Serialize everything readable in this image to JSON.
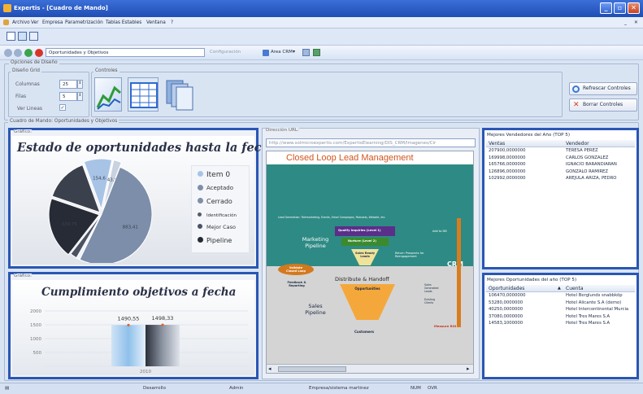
{
  "window": {
    "title": "Expertis - [Cuadro de Mando]"
  },
  "menu": {
    "items": [
      "Archivo",
      "Ver",
      "Empresa",
      "Parametrización",
      "Tablas Estables",
      "Ventana",
      "?"
    ]
  },
  "toolbar": {
    "combo_value": "Oportunidades y Objetivos",
    "config_label": "Configuración",
    "area_label": "Area CRM"
  },
  "options": {
    "group_label": "Opciones de Diseño",
    "grid_label": "Diseño Grid",
    "columns_label": "Columnas",
    "columns_value": "25",
    "rows_label": "Filas",
    "rows_value": "5",
    "lines_label": "Ver Lineas",
    "controls_label": "Controles",
    "refresh_label": "Refrescar Controles",
    "delete_label": "Borrar Controles"
  },
  "dashboard": {
    "label": "Cuadro de Mando: Oportunidades y Objetivos"
  },
  "pie_panel": {
    "label": "Gráfico:"
  },
  "bar_panel": {
    "label": "Gráfico:"
  },
  "url_panel": {
    "label": "Dirección URL:",
    "url": "http://www.solmicroexpertis.com/ExpertisElearning/DIS_CRM/Imagenes/Cir"
  },
  "clm": {
    "title": "Closed Loop Lead Management",
    "top_line": "Lead Generation: Telemarketing, Events, Email Campaigns, Podcasts, Website, etc.",
    "marketing_pipeline": "Marketing Pipeline",
    "qualify": "Qualify Inquiries (Level 1)",
    "nurture": "Nurture (Level 2)",
    "sales_ready": "Sales Ready Leads",
    "add_to_db": "Add to DB",
    "return_prospects": "Return Prospects for Reengagement",
    "crm": "CRM",
    "validate": "Validate Closed Loop",
    "feedback": "Feedback & Reporting",
    "distribute": "Distribute & Handoff",
    "opportunities": "Opportunities",
    "sales_pipeline": "Sales Pipeline",
    "sales_generated": "Sales Generated Leads",
    "existing_clients": "Existing Clients",
    "customers": "Customers",
    "measure_roi": "Measure ROI"
  },
  "sellers": {
    "title": "Mejores Vendedores del Año (TOP 5)",
    "col1": "Ventas",
    "col2": "Vendedor",
    "rows": [
      [
        "207900,0000000",
        "TERESA PEREZ"
      ],
      [
        "169998,0000000",
        "CARLOS GONZALEZ"
      ],
      [
        "165766,0000000",
        "IGNACIO BARANDIARAN"
      ],
      [
        "126896,0000000",
        "GONZALO RAMIREZ"
      ],
      [
        "102992,0000000",
        "AREJULA ARIZA, PEDRO"
      ]
    ]
  },
  "opps": {
    "title": "Mejores Oportunidades del año (TOP 5)",
    "col1": "Oportunidades",
    "col2": "Cuenta",
    "rows": [
      [
        "106470,0000000",
        "Hotel Berglunds snabbköp"
      ],
      [
        "53280,0000000",
        "Hotel Alicante S.A (demo)"
      ],
      [
        "40250,0000000",
        "Hotel Intercontinental Murcia"
      ],
      [
        "37080,0000000",
        "Hotel Tres Mares S.A"
      ],
      [
        "14583,1000000",
        "Hotel Tres Mares S.A"
      ]
    ]
  },
  "status": {
    "items": [
      "Desarrollo",
      "Admin",
      "Empresa/sistema martinez",
      "NUM",
      "OVR"
    ]
  },
  "chart_data": [
    {
      "type": "pie",
      "title": "Estado de oportunidades hasta la fecha",
      "legend": [
        "Item 0",
        "Aceptado",
        "Cerrado",
        "Identificación",
        "Mejor Caso",
        "Pipeline"
      ],
      "legend_placement": "right",
      "values": [
        154.6,
        43.9,
        883.41,
        20,
        38,
        339.75,
        245.0
      ],
      "labels": [
        "154,6",
        "43,9",
        "883,41",
        "",
        "",
        "339,75",
        "245,0"
      ],
      "colors": [
        "#a7c4e6",
        "#c8d2e0",
        "#7c8ea9",
        "#f0f3f8",
        "#4b5363",
        "#262b36",
        "#3a404c"
      ]
    },
    {
      "type": "bar",
      "title": "Cumplimiento objetivos a fecha",
      "categories": [
        "2010"
      ],
      "series": [
        {
          "values": [
            1490.55
          ]
        },
        {
          "values": [
            1498.33
          ]
        }
      ],
      "value_labels": [
        "1490,55",
        "1498,33"
      ],
      "yticks": [
        "2000",
        "1500",
        "1000",
        "500",
        ""
      ],
      "ylim": [
        0,
        2000
      ],
      "grid": true
    }
  ]
}
